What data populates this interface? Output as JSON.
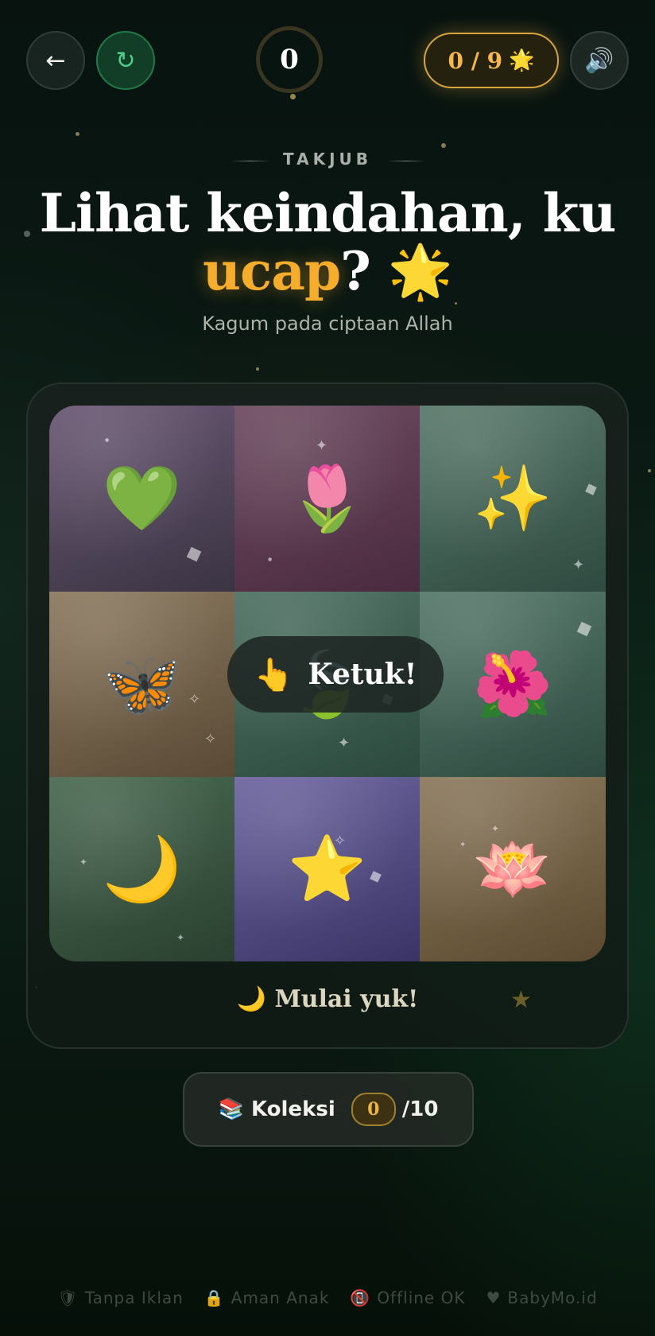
{
  "header": {
    "back_icon": "←",
    "reset_icon": "↻",
    "sound_icon": "🔊",
    "score": "0",
    "progress_text": "0 / 9",
    "progress_icon": "🌟"
  },
  "hero": {
    "eyebrow": "TAKJUB",
    "title_line1": "Lihat keindahan, ku",
    "title_accent": "ucap",
    "title_suffix": "? 🌟",
    "subtitle": "Kagum pada ciptaan Allah"
  },
  "grid": {
    "tiles": [
      {
        "emoji": "💚",
        "color_top": "#6b5874",
        "color_bottom": "#3a3443"
      },
      {
        "emoji": "🌷",
        "color_top": "#6e4c62",
        "color_bottom": "#4a2a3e"
      },
      {
        "emoji": "✨",
        "color_top": "#5a7a6c",
        "color_bottom": "#2f4a40"
      },
      {
        "emoji": "🦋",
        "color_top": "#8c7a60",
        "color_bottom": "#5a4a36"
      },
      {
        "emoji": "🍃",
        "color_top": "#4f7264",
        "color_bottom": "#2c4a3e"
      },
      {
        "emoji": "🌺",
        "color_top": "#587a6c",
        "color_bottom": "#2e4a40"
      },
      {
        "emoji": "🌙",
        "color_top": "#4a6a52",
        "color_bottom": "#2a4030"
      },
      {
        "emoji": "⭐",
        "color_top": "#6e66a0",
        "color_bottom": "#3a3466"
      },
      {
        "emoji": "🪷",
        "color_top": "#8c7a5e",
        "color_bottom": "#5c4a30"
      }
    ],
    "tap_hint_icon": "👆",
    "tap_hint_label": "Ketuk!"
  },
  "status": {
    "text": "🌙 Mulai yuk!"
  },
  "collection": {
    "label": "📚 Koleksi",
    "count": "0",
    "total": "/10"
  },
  "footer": {
    "items": [
      {
        "icon": "🛡",
        "label": "Tanpa Iklan"
      },
      {
        "icon": "🔒",
        "label": "Aman Anak"
      },
      {
        "icon": "📵",
        "label": "Offline OK"
      },
      {
        "icon": "♥",
        "label": "BabyMo.id"
      }
    ]
  }
}
